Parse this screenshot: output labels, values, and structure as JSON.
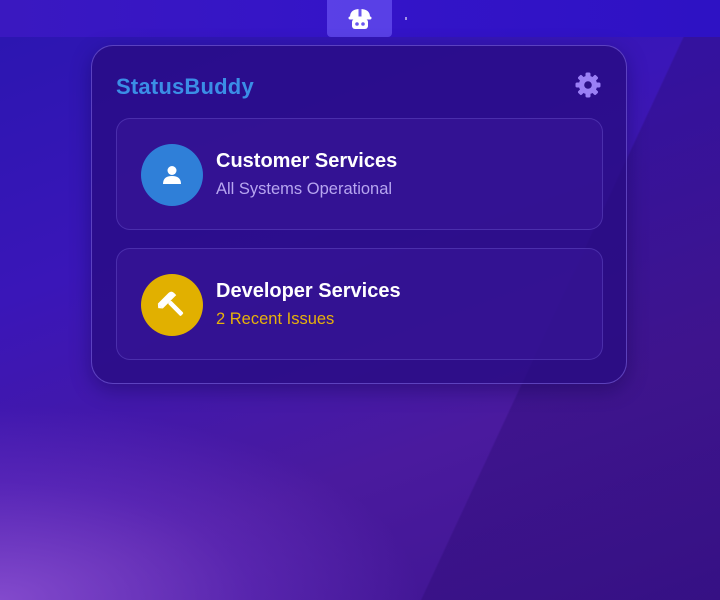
{
  "menubar": {
    "icon": "helmet-robot-icon"
  },
  "app": {
    "title": "StatusBuddy",
    "settings_icon": "gear-icon"
  },
  "services": [
    {
      "name": "Customer Services",
      "status": "All Systems Operational",
      "status_color": "#b7a6f0",
      "icon": "person-icon",
      "icon_bg": "#2f7fd8"
    },
    {
      "name": "Developer Services",
      "status": "2 Recent Issues",
      "status_color": "#e7b10a",
      "icon": "hammer-icon",
      "icon_bg": "#e1b000"
    }
  ],
  "colors": {
    "title": "#3b8ee6",
    "panel": "#2c0f88"
  }
}
